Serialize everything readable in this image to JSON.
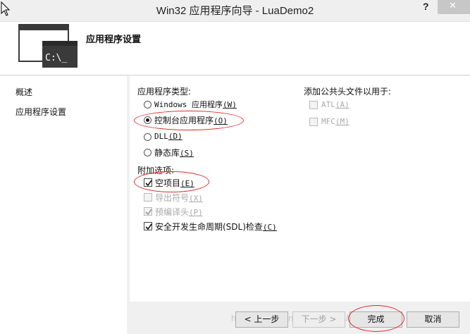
{
  "window": {
    "title": "Win32 应用程序向导 - LuaDemo2",
    "help_label": "?",
    "close_label": "✕"
  },
  "header": {
    "title": "应用程序设置",
    "icon_text": "C:\\_"
  },
  "nav": {
    "items": [
      {
        "label": "概述"
      },
      {
        "label": "应用程序设置"
      }
    ]
  },
  "app_type": {
    "label": "应用程序类型:",
    "options": [
      {
        "label": "Windows 应用程序",
        "key": "(W)",
        "checked": false
      },
      {
        "label": "控制台应用程序",
        "key": "(O)",
        "checked": true
      },
      {
        "label": "DLL",
        "key": "(D)",
        "checked": false
      },
      {
        "label": "静态库",
        "key": "(S)",
        "checked": false
      }
    ]
  },
  "headers": {
    "label": "添加公共头文件以用于:",
    "options": [
      {
        "label": "ATL",
        "key": "(A)",
        "checked": false,
        "enabled": false
      },
      {
        "label": "MFC",
        "key": "(M)",
        "checked": false,
        "enabled": false
      }
    ]
  },
  "extra": {
    "label": "附加选项:",
    "options": [
      {
        "label": "空项目",
        "key": "(E)",
        "checked": true,
        "enabled": true
      },
      {
        "label": "导出符号",
        "key": "(X)",
        "checked": false,
        "enabled": false
      },
      {
        "label": "预编译头",
        "key": "(P)",
        "checked": true,
        "enabled": false
      },
      {
        "label": "安全开发生命周期(SDL)检查",
        "key": "(C)",
        "checked": true,
        "enabled": true
      }
    ]
  },
  "buttons": {
    "prev": "< 上一步",
    "next": "下一步 >",
    "finish": "完成",
    "cancel": "取消"
  },
  "watermark": "http://blog.csdn.net/ykood2d/2014",
  "colors": {
    "annotation": "#e0282a",
    "panel_bg": "#ffffff",
    "window_bg": "#f0f0f0"
  }
}
